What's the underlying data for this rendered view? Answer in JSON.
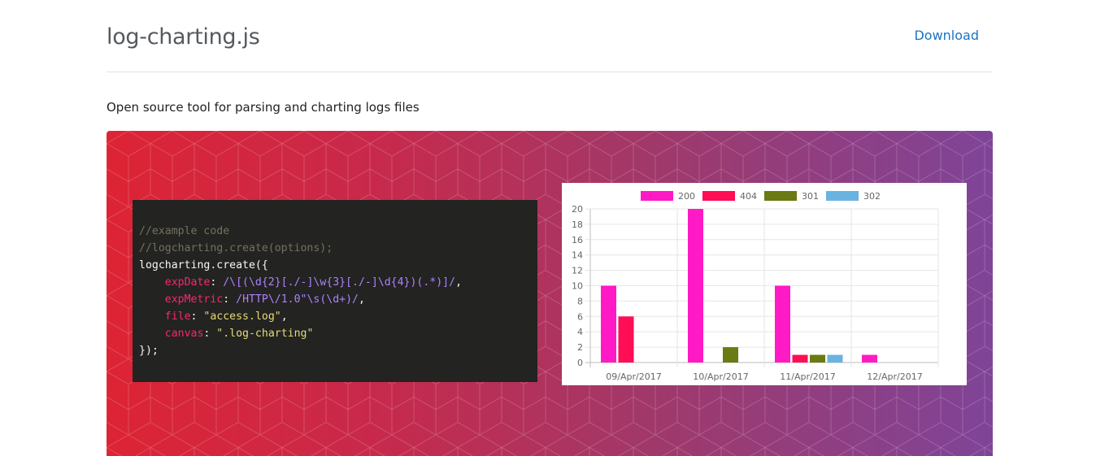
{
  "header": {
    "title": "log-charting.js",
    "download_label": "Download"
  },
  "tagline": "Open source tool for parsing and charting logs files",
  "code": {
    "comment1": "//example code",
    "comment2": "//logcharting.create(options);",
    "call_open": "logcharting.create({",
    "lines": [
      {
        "key": "expDate",
        "value": "/\\[(\\d{2}[./-]\\w{3}[./-]\\d{4})(.*)]/",
        "kind": "regex"
      },
      {
        "key": "expMetric",
        "value": "/HTTP\\/1.0\"\\s(\\d+)/",
        "kind": "regex"
      },
      {
        "key": "file",
        "value": "\"access.log\"",
        "kind": "string"
      },
      {
        "key": "canvas",
        "value": "\".log-charting\"",
        "kind": "string"
      }
    ],
    "call_close": "});"
  },
  "chart_data": {
    "type": "bar",
    "categories": [
      "09/Apr/2017",
      "10/Apr/2017",
      "11/Apr/2017",
      "12/Apr/2017"
    ],
    "series": [
      {
        "name": "200",
        "color": "#ff1ac6",
        "values": [
          10,
          20,
          10,
          1
        ]
      },
      {
        "name": "404",
        "color": "#ff0d55",
        "values": [
          6,
          0,
          1,
          0
        ]
      },
      {
        "name": "301",
        "color": "#6b7a12",
        "values": [
          0,
          2,
          1,
          0
        ]
      },
      {
        "name": "302",
        "color": "#6ab3e0",
        "values": [
          0,
          0,
          1,
          0
        ]
      }
    ],
    "yticks": [
      0,
      2,
      4,
      6,
      8,
      10,
      12,
      14,
      16,
      18,
      20
    ],
    "ylim": [
      0,
      20
    ],
    "grid": true,
    "legend": "top"
  }
}
